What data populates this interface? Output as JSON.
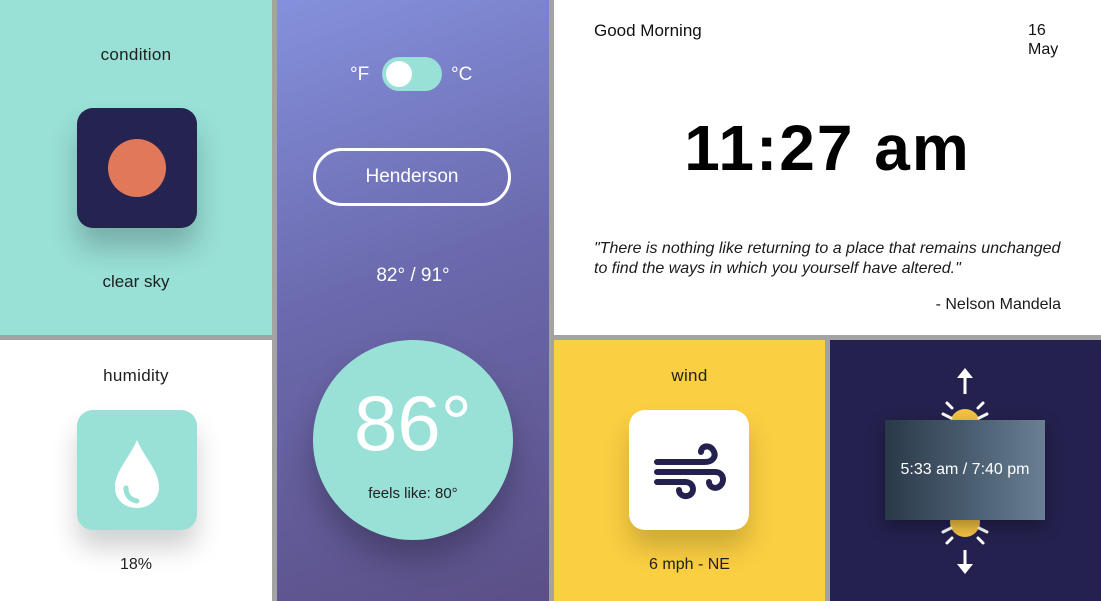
{
  "condition": {
    "title": "condition",
    "text": "clear sky",
    "icon": "sun-icon",
    "icon_color": "#e1785a"
  },
  "humidity": {
    "title": "humidity",
    "value": "18%",
    "icon": "water-drop-icon"
  },
  "temperature": {
    "unit_f": "°F",
    "unit_c": "°C",
    "city": "Henderson",
    "range": "82° / 91°",
    "current": "86°",
    "feels_like": "feels like: 80°"
  },
  "header": {
    "greeting": "Good Morning",
    "day": "16",
    "month": "May"
  },
  "clock": {
    "time": "11:27 am"
  },
  "quote": {
    "text": "\"There is nothing like returning to a place that remains unchanged to find the ways in which you yourself have altered.\"",
    "author": "- Nelson Mandela"
  },
  "wind": {
    "title": "wind",
    "value": "6 mph - NE",
    "icon": "wind-icon"
  },
  "sun": {
    "times": "5:33 am / 7:40 pm",
    "icons": [
      "sunrise-icon",
      "sunset-icon"
    ]
  },
  "colors": {
    "teal": "#99e0d7",
    "navy": "#24214f",
    "yellow": "#fbcf42",
    "sun_orange": "#e1785a",
    "sun_yellow": "#f6c443"
  }
}
